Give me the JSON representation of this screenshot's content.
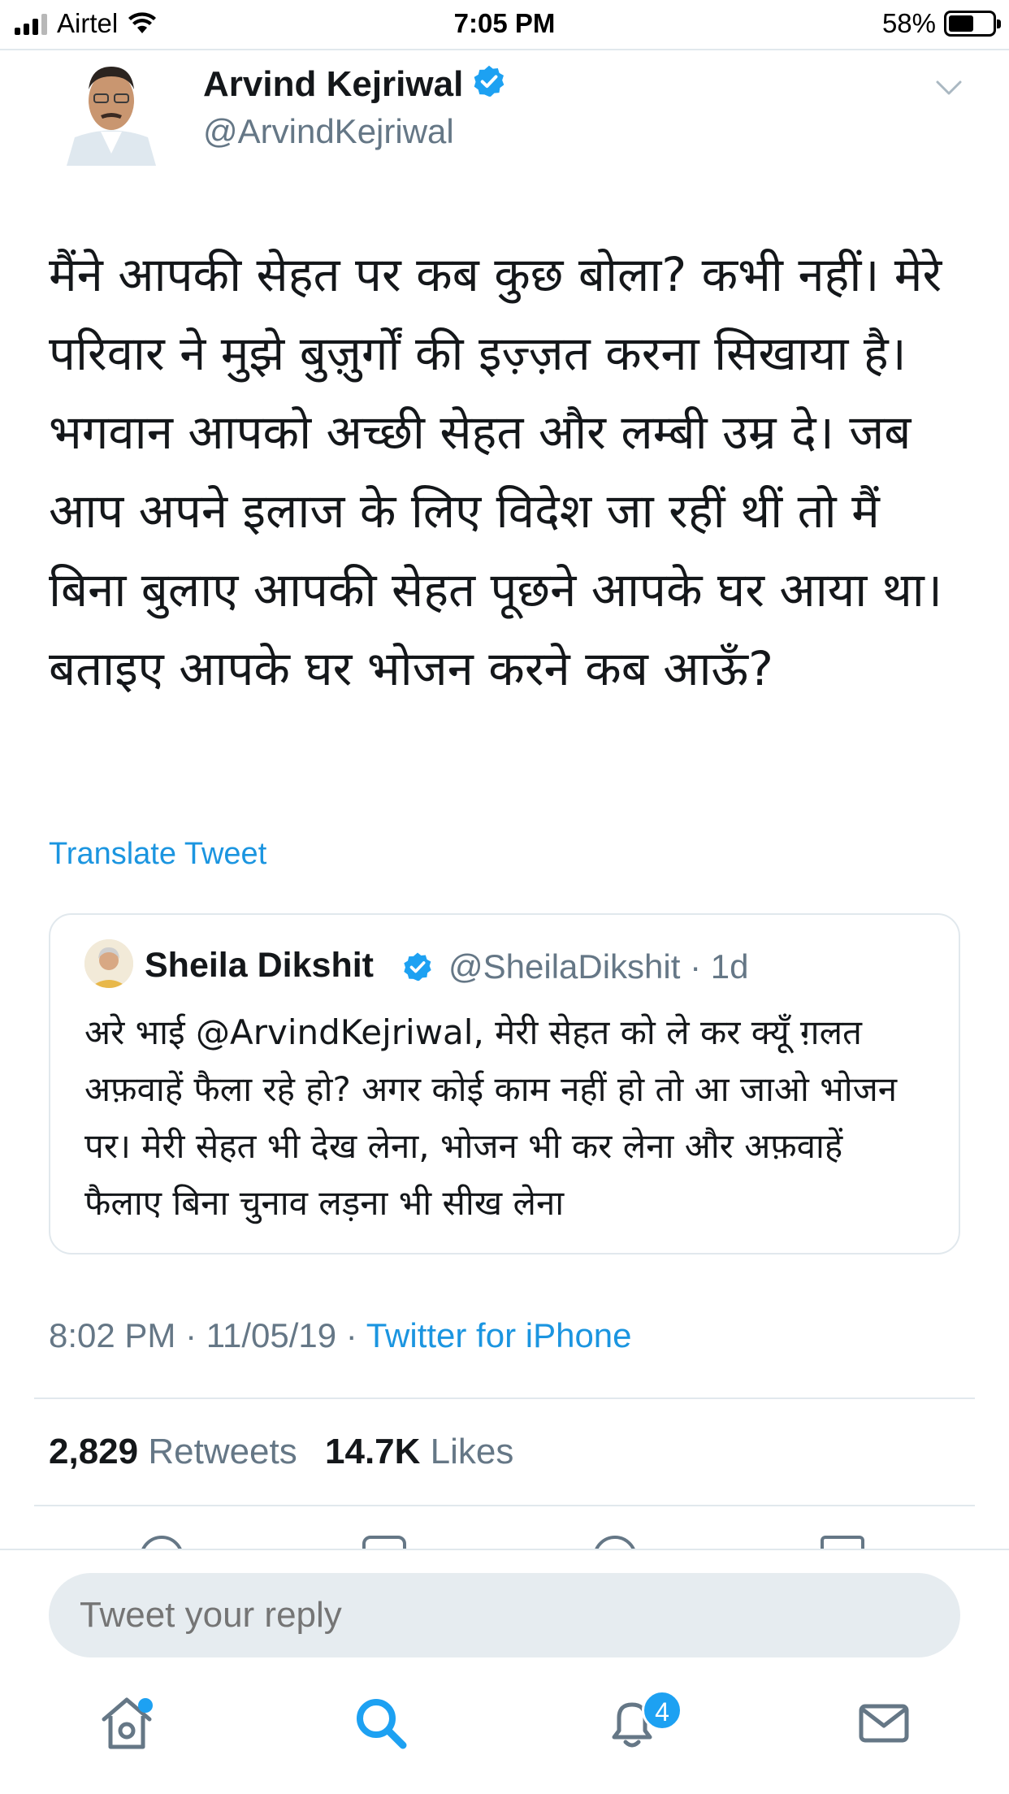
{
  "status_bar": {
    "carrier": "Airtel",
    "time": "7:05 PM",
    "battery": "58%",
    "battery_level": 0.58
  },
  "tweet": {
    "display_name": "Arvind Kejriwal",
    "handle": "@ArvindKejriwal",
    "text": "मैंने आपकी सेहत पर कब कुछ बोला? कभी नहीं। मेरे परिवार ने मुझे बुज़ुर्गों की इज़्ज़त करना सिखाया है। भगवान आपको अच्छी सेहत और लम्बी उम्र दे। जब आप अपने इलाज के लिए विदेश जा रहीं थीं तो मैं बिना बुलाए आपकी सेहत पूछने आपके घर आया था। बताइए आपके घर भोजन करने कब आऊँ?",
    "translate_label": "Translate Tweet",
    "time": "8:02 PM",
    "date": "11/05/19",
    "source": "Twitter for iPhone",
    "separator": " · ",
    "retweets_count": "2,829",
    "retweets_label": "Retweets",
    "likes_count": "14.7K",
    "likes_label": "Likes"
  },
  "quoted_tweet": {
    "display_name": "Sheila Dikshit",
    "handle": "@SheilaDikshit",
    "age": "· 1d",
    "text": "अरे भाई @ArvindKejriwal, मेरी सेहत को ले कर क्यूँ ग़लत अफ़वाहें फैला रहे हो? अगर कोई काम नहीं हो तो आ जाओ भोजन पर। मेरी सेहत भी देख लेना, भोजन भी कर लेना और अफ़वाहें फैलाए बिना चुनाव लड़ना भी सीख लेना"
  },
  "reply": {
    "placeholder": "Tweet your reply"
  },
  "tab_bar": {
    "items": [
      "home-icon",
      "search-icon",
      "notifications-icon",
      "messages-icon"
    ],
    "notifications_badge": "4",
    "active_color": "#1da1f2",
    "inactive_color": "#657786"
  },
  "colors": {
    "link": "#1b95e0",
    "secondary": "#657786",
    "verified": "#1da1f2"
  }
}
